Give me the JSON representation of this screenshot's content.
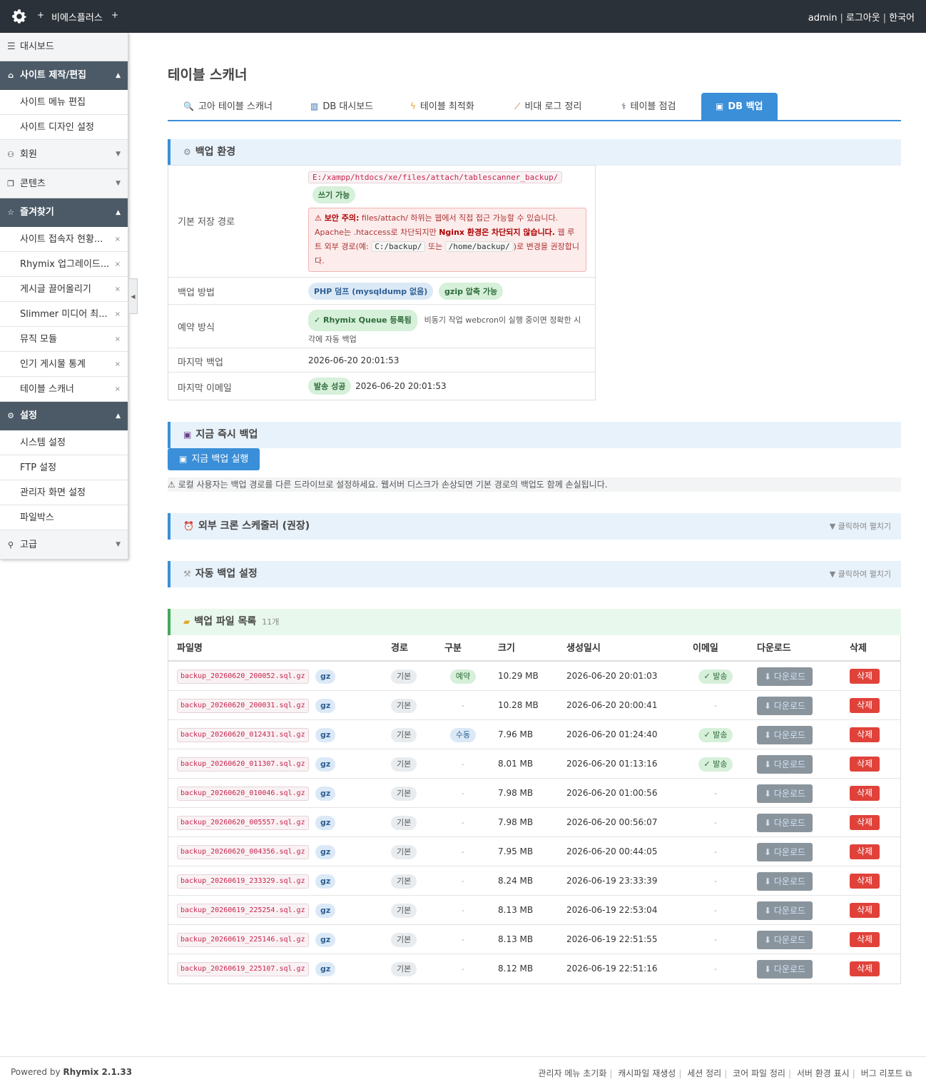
{
  "topbar": {
    "logo_icon": "gear-icon",
    "plus": "+",
    "site_name": "비에스플러스",
    "user": "admin",
    "logout": "로그아웃",
    "language": "한국어"
  },
  "sidebar": {
    "dashboard": "대시보드",
    "groups": {
      "site": {
        "label": "사이트 제작/편집",
        "items": [
          "사이트 메뉴 편집",
          "사이트 디자인 설정"
        ]
      },
      "member": {
        "label": "회원"
      },
      "content": {
        "label": "콘텐츠"
      },
      "favorites": {
        "label": "즐겨찾기",
        "items": [
          "사이트 접속자 현황...",
          "Rhymix 업그레이드...",
          "게시글 끌어올리기",
          "Slimmer 미디어 최...",
          "뮤직 모듈",
          "인기 게시물 통계",
          "테이블 스캐너"
        ]
      },
      "settings": {
        "label": "설정",
        "items": [
          "시스템 설정",
          "FTP 설정",
          "관리자 화면 설정",
          "파일박스"
        ]
      },
      "advanced": {
        "label": "고급"
      }
    },
    "remove_mark": "×"
  },
  "page": {
    "title": "테이블 스캐너",
    "tabs": [
      "고아 테이블 스캐너",
      "DB 대시보드",
      "테이블 최적화",
      "비대 로그 정리",
      "테이블 점검",
      "DB 백업"
    ],
    "active_tab": "DB 백업"
  },
  "backup_env": {
    "title": "백업 환경",
    "path_label": "기본 저장 경로",
    "path": "E:/xampp/htdocs/xe/files/attach/tablescanner_backup/",
    "writable": "쓰기 가능",
    "warn_title": "⚠ 보안 주의:",
    "warn_1": " files/attach/ 하위는 웹에서 직접 접근 가능할 수 있습니다. Apache는 .htaccess로 차단되지만 ",
    "warn_bold": "Nginx 환경은 차단되지 않습니다.",
    "warn_2": " 웹 루트 외부 경로(예: ",
    "warn_code1": "C:/backup/",
    "warn_3": " 또는 ",
    "warn_code2": "/home/backup/",
    "warn_4": ")로 변경을 권장합니다.",
    "method_label": "백업 방법",
    "method_dump": "PHP 덤프 (mysqldump 없음)",
    "method_gzip": "gzip 압축 가능",
    "schedule_label": "예약 방식",
    "schedule_badge": "✓ Rhymix Queue 등록됨",
    "schedule_desc": "비동기 작업 webcron이 실행 중이면 정확한 시각에 자동 백업",
    "last_backup_label": "마지막 백업",
    "last_backup": "2026-06-20 20:01:53",
    "last_email_label": "마지막 이메일",
    "last_email_status": "발송 성공",
    "last_email_time": "2026-06-20 20:01:53"
  },
  "instant_backup": {
    "title": "지금 즉시 백업",
    "button": "지금 백업 실행",
    "note": "⚠ 로컬 사용자는 백업 경로를 다른 드라이브로 설정하세요. 웹서버 디스크가 손상되면 기본 경로의 백업도 함께 손실됩니다."
  },
  "cron": {
    "title": "외부 크론 스케줄러 (권장)",
    "expand": "▼ 클릭하여 펼치기"
  },
  "auto_backup": {
    "title": "자동 백업 설정",
    "expand": "▼ 클릭하여 펼치기"
  },
  "files": {
    "title": "백업 파일 목록",
    "count": "11개",
    "headers": {
      "name": "파일명",
      "path": "경로",
      "type": "구분",
      "size": "크기",
      "created": "생성일시",
      "email": "이메일",
      "download": "다운로드",
      "delete": "삭제"
    },
    "gz_label": "gz",
    "download_label": "⬇ 다운로드",
    "delete_label": "삭제",
    "rows": [
      {
        "name": "backup_20260620_200052.sql.gz",
        "path": "기본",
        "type": "예약",
        "type_style": "green",
        "size": "10.29 MB",
        "created": "2026-06-20 20:01:03",
        "email": "✓ 발송"
      },
      {
        "name": "backup_20260620_200031.sql.gz",
        "path": "기본",
        "type": "-",
        "type_style": "dash",
        "size": "10.28 MB",
        "created": "2026-06-20 20:00:41",
        "email": "-"
      },
      {
        "name": "backup_20260620_012431.sql.gz",
        "path": "기본",
        "type": "수동",
        "type_style": "blue",
        "size": "7.96 MB",
        "created": "2026-06-20 01:24:40",
        "email": "✓ 발송"
      },
      {
        "name": "backup_20260620_011307.sql.gz",
        "path": "기본",
        "type": "-",
        "type_style": "dash",
        "size": "8.01 MB",
        "created": "2026-06-20 01:13:16",
        "email": "✓ 발송"
      },
      {
        "name": "backup_20260620_010046.sql.gz",
        "path": "기본",
        "type": "-",
        "type_style": "dash",
        "size": "7.98 MB",
        "created": "2026-06-20 01:00:56",
        "email": "-"
      },
      {
        "name": "backup_20260620_005557.sql.gz",
        "path": "기본",
        "type": "-",
        "type_style": "dash",
        "size": "7.98 MB",
        "created": "2026-06-20 00:56:07",
        "email": "-"
      },
      {
        "name": "backup_20260620_004356.sql.gz",
        "path": "기본",
        "type": "-",
        "type_style": "dash",
        "size": "7.95 MB",
        "created": "2026-06-20 00:44:05",
        "email": "-"
      },
      {
        "name": "backup_20260619_233329.sql.gz",
        "path": "기본",
        "type": "-",
        "type_style": "dash",
        "size": "8.24 MB",
        "created": "2026-06-19 23:33:39",
        "email": "-"
      },
      {
        "name": "backup_20260619_225254.sql.gz",
        "path": "기본",
        "type": "-",
        "type_style": "dash",
        "size": "8.13 MB",
        "created": "2026-06-19 22:53:04",
        "email": "-"
      },
      {
        "name": "backup_20260619_225146.sql.gz",
        "path": "기본",
        "type": "-",
        "type_style": "dash",
        "size": "8.13 MB",
        "created": "2026-06-19 22:51:55",
        "email": "-"
      },
      {
        "name": "backup_20260619_225107.sql.gz",
        "path": "기본",
        "type": "-",
        "type_style": "dash",
        "size": "8.12 MB",
        "created": "2026-06-19 22:51:16",
        "email": "-"
      }
    ]
  },
  "footer": {
    "powered_by": "Powered by",
    "brand": "Rhymix 2.1.33",
    "links": [
      "관리자 메뉴 초기화",
      "캐시파일 재생성",
      "세션 정리",
      "코어 파일 정리",
      "서버 환경 표시",
      "버그 리포트"
    ]
  },
  "colors": {
    "accent": "#3a8fd8",
    "topbar": "#2b3138",
    "sidebar_group": "#4b5a66",
    "danger": "#e0423a"
  }
}
